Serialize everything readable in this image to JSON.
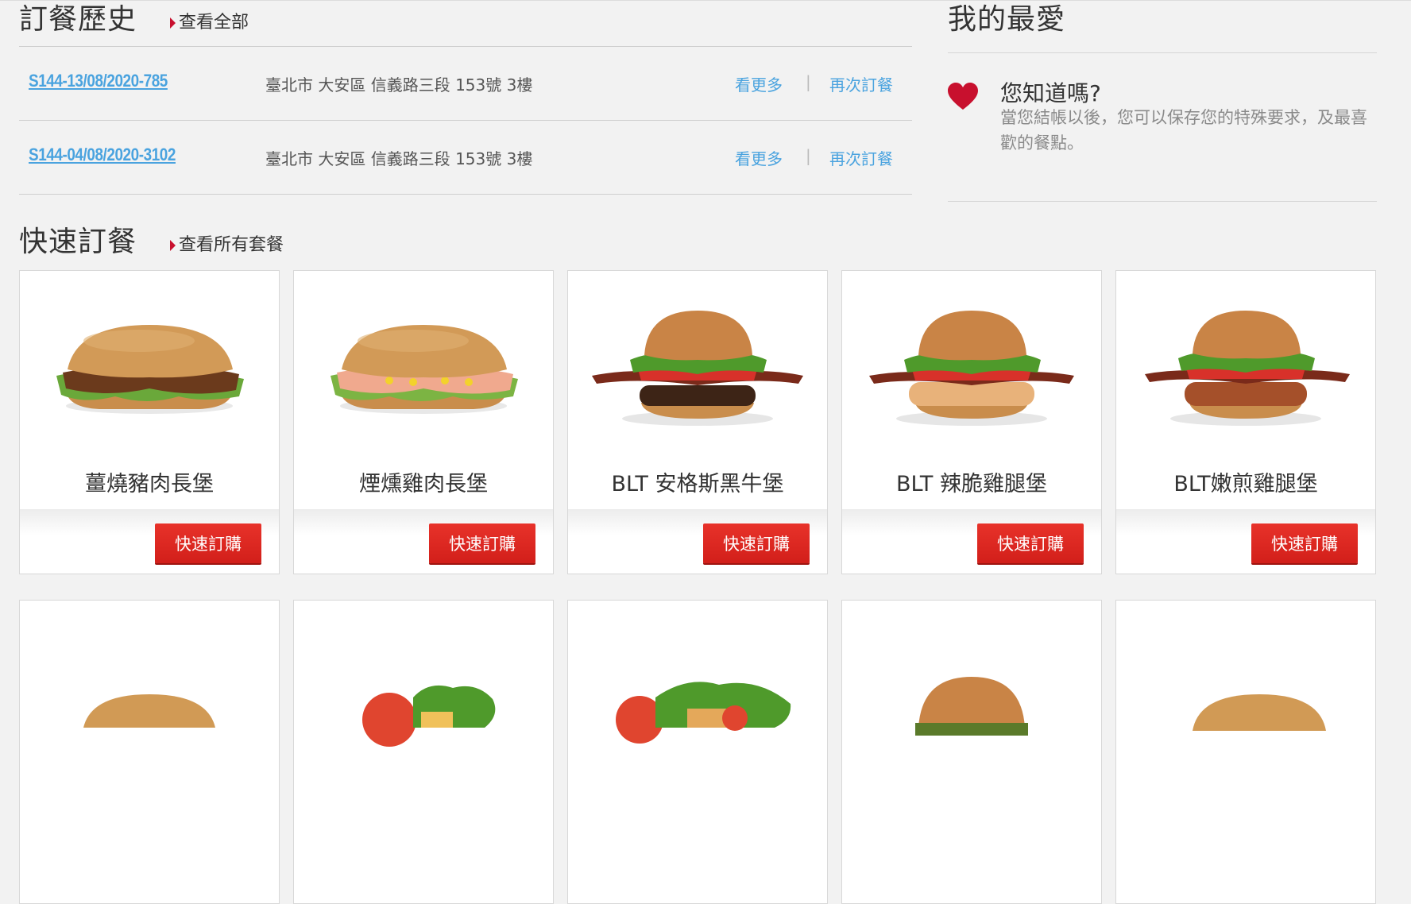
{
  "order_history": {
    "title": "訂餐歷史",
    "view_all": "查看全部",
    "orders": [
      {
        "id": "S144-13/08/2020-785",
        "address": "臺北市 大安區 信義路三段 153號 3樓",
        "more": "看更多",
        "sep": "|",
        "reorder": "再次訂餐"
      },
      {
        "id": "S144-04/08/2020-3102",
        "address": "臺北市 大安區 信義路三段 153號 3樓",
        "more": "看更多",
        "sep": "|",
        "reorder": "再次訂餐"
      }
    ]
  },
  "favorites": {
    "title": "我的最愛",
    "tip_title": "您知道嗎?",
    "tip_text": "當您結帳以後，您可以保存您的特殊要求，及最喜歡的餐點。"
  },
  "quick_order": {
    "title": "快速訂餐",
    "view_all": "查看所有套餐",
    "items": [
      {
        "name": "薑燒豬肉長堡",
        "button": "快速訂購",
        "icon": "long-sandwich-pork"
      },
      {
        "name": "煙燻雞肉長堡",
        "button": "快速訂購",
        "icon": "long-sandwich-chicken"
      },
      {
        "name": "BLT 安格斯黑牛堡",
        "button": "快速訂購",
        "icon": "burger-beef"
      },
      {
        "name": "BLT 辣脆雞腿堡",
        "button": "快速訂購",
        "icon": "burger-crispy-chicken"
      },
      {
        "name": "BLT嫩煎雞腿堡",
        "button": "快速訂購",
        "icon": "burger-grilled-chicken"
      }
    ],
    "second_row_icons": [
      "burger-bun",
      "salad",
      "salad",
      "burger",
      "burger-bun"
    ]
  },
  "colors": {
    "link": "#4aa3df",
    "accent": "#c8102e",
    "button": "#d9251e",
    "background": "#f2f2f2"
  }
}
